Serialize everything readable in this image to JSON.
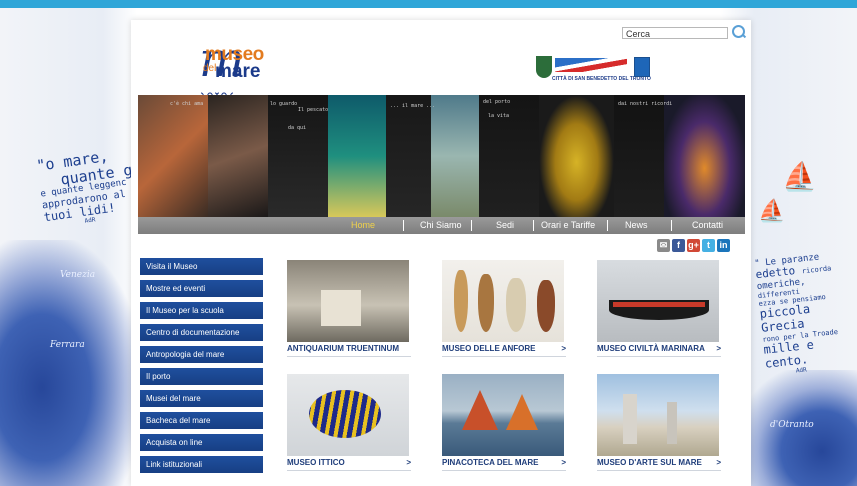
{
  "left_poem": {
    "l1": "\"o mare,",
    "l2": "quante ge",
    "l3": "e quante leggenc",
    "l4": "approdarono al",
    "l5": "tuoi lidi!",
    "author": "AdR"
  },
  "right_poem": {
    "r1": "\" Le paranze",
    "r2": "edetto",
    "r2b": "ricorda",
    "r3": "omeriche,",
    "r4": "differenti",
    "r5": "ezza se pensiamo",
    "r6": "piccola Grecia",
    "r7": "rono per la Troade",
    "r8": "mille e cento.",
    "author": "AdR"
  },
  "map_labels": {
    "venezia": "Venezia",
    "ferrara": "Ferrara",
    "otranto": "d'Otranto"
  },
  "logo": {
    "big_m": "m",
    "museo": "museo",
    "del": "del",
    "mare": "mare"
  },
  "header": {
    "search_placeholder": "Cerca",
    "city_caption": "CITTÀ DI SAN BENEDETTO DEL TRONTO"
  },
  "hero_texts": [
    "c'è chi ama",
    "lo guardo",
    "da qui",
    "Il pescato",
    "... il mare ...",
    "del porto",
    "la vita",
    "dai nostri ricordi"
  ],
  "nav": {
    "items": [
      {
        "label": "Home",
        "active": true
      },
      {
        "label": "Chi Siamo",
        "active": false
      },
      {
        "label": "Sedi",
        "active": false
      },
      {
        "label": "Orari e Tariffe",
        "active": false
      },
      {
        "label": "News",
        "active": false
      },
      {
        "label": "Contatti",
        "active": false
      }
    ]
  },
  "social": [
    {
      "name": "email",
      "glyph": "✉",
      "color": "#8a8a8a"
    },
    {
      "name": "facebook",
      "glyph": "f",
      "color": "#3b5998"
    },
    {
      "name": "googleplus",
      "glyph": "g+",
      "color": "#d14836"
    },
    {
      "name": "twitter",
      "glyph": "t",
      "color": "#45b0e3"
    },
    {
      "name": "linkedin",
      "glyph": "in",
      "color": "#1b75bb"
    }
  ],
  "side_menu": [
    "Visita il Museo",
    "Mostre ed eventi",
    "Il Museo per la scuola",
    "Centro di documentazione",
    "Antropologia del mare",
    "Il porto",
    "Musei del mare",
    "Bacheca del mare",
    "Acquista on line",
    "Link istituzionali"
  ],
  "cards": [
    {
      "label": "ANTIQUARIUM TRUENTINUM",
      "arrow": ""
    },
    {
      "label": "MUSEO DELLE ANFORE",
      "arrow": ">"
    },
    {
      "label": "MUSEO CIVILTÀ MARINARA",
      "arrow": ">"
    },
    {
      "label": "MUSEO ITTICO",
      "arrow": ">"
    },
    {
      "label": "PINACOTECA DEL MARE",
      "arrow": ">"
    },
    {
      "label": "MUSEO D'ARTE SUL MARE",
      "arrow": ">"
    }
  ]
}
